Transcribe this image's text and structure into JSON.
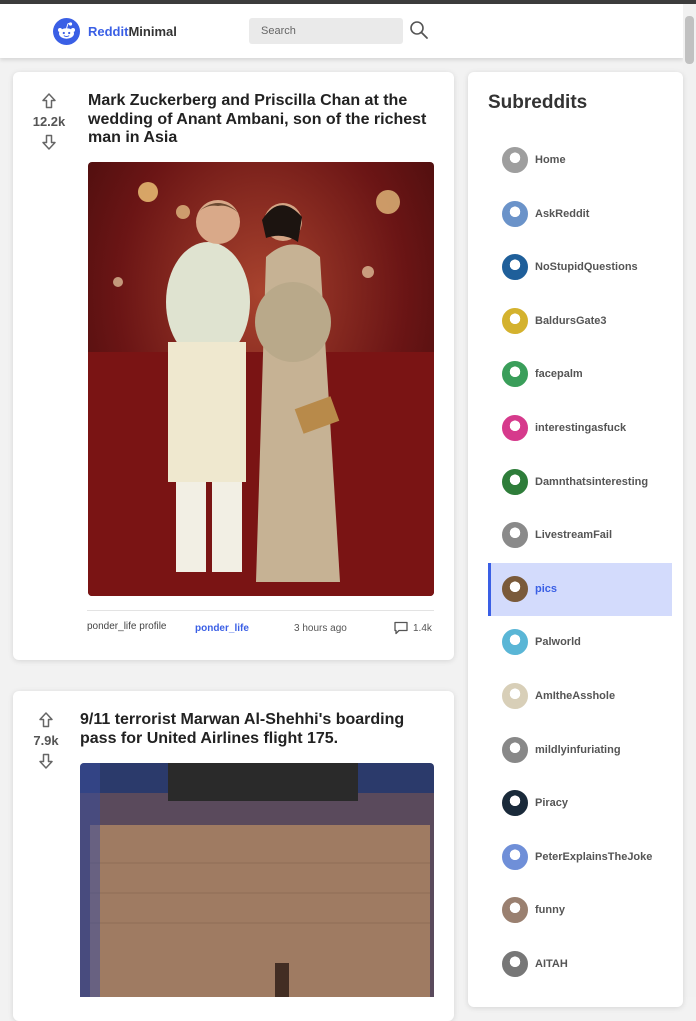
{
  "header": {
    "brand_accent": "Reddit",
    "brand_rest": "Minimal",
    "search_placeholder": "Search"
  },
  "posts": [
    {
      "score": "12.2k",
      "title": "Mark Zuckerberg and Priscilla Chan at the wedding of Anant Ambani, son of the richest man in Asia",
      "author_avatar_alt": "ponder_life profile",
      "author": "ponder_life",
      "time": "3 hours ago",
      "comments": "1.4k"
    },
    {
      "score": "7.9k",
      "title": "9/11 terrorist Marwan Al-Shehhi's boarding pass for United Airlines flight 175."
    }
  ],
  "sidebar": {
    "heading": "Subreddits",
    "items": [
      {
        "label": "Home",
        "color": "#9e9e9e"
      },
      {
        "label": "AskReddit",
        "color": "#6b93c9"
      },
      {
        "label": "NoStupidQuestions",
        "color": "#1f5f9a"
      },
      {
        "label": "BaldursGate3",
        "color": "#d4b22e"
      },
      {
        "label": "facepalm",
        "color": "#3a9e5a"
      },
      {
        "label": "interestingasfuck",
        "color": "#d63a8c"
      },
      {
        "label": "Damnthatsinteresting",
        "color": "#2e7d3a"
      },
      {
        "label": "LivestreamFail",
        "color": "#8a8a8a"
      },
      {
        "label": "pics",
        "color": "#7a5a3a",
        "active": true
      },
      {
        "label": "Palworld",
        "color": "#5ab6d6"
      },
      {
        "label": "AmItheAsshole",
        "color": "#d8cfb8"
      },
      {
        "label": "mildlyinfuriating",
        "color": "#888888"
      },
      {
        "label": "Piracy",
        "color": "#1a2a3a"
      },
      {
        "label": "PeterExplainsTheJoke",
        "color": "#6f8fd8"
      },
      {
        "label": "funny",
        "color": "#9a8070"
      },
      {
        "label": "AITAH",
        "color": "#777777"
      }
    ]
  },
  "colors": {
    "accent": "#3a5fe5",
    "active_bg": "#d3dbfc"
  }
}
